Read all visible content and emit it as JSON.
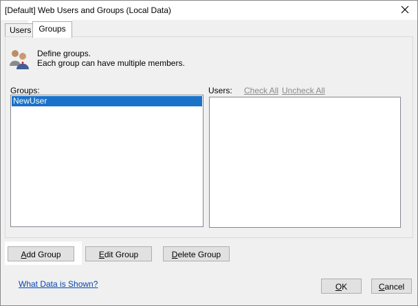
{
  "window": {
    "title": "[Default] Web Users and Groups (Local Data)"
  },
  "tabs": [
    {
      "label": "Users",
      "active": false
    },
    {
      "label": "Groups",
      "active": true
    }
  ],
  "description": {
    "line1": "Define groups.",
    "line2": "Each group can have multiple members."
  },
  "groups_list": {
    "label": "Groups:",
    "items": [
      {
        "label": "NewUser",
        "selected": true
      }
    ]
  },
  "users_list": {
    "label": "Users:",
    "check_all": "Check All",
    "uncheck_all": "Uncheck All",
    "items": []
  },
  "buttons": {
    "add_group": {
      "pre": "",
      "mnemonic": "A",
      "post": "dd Group"
    },
    "edit_group": {
      "pre": "",
      "mnemonic": "E",
      "post": "dit Group"
    },
    "delete_group": {
      "pre": "",
      "mnemonic": "D",
      "post": "elete Group"
    },
    "ok": {
      "pre": "",
      "mnemonic": "O",
      "post": "K"
    },
    "cancel": {
      "pre": "",
      "mnemonic": "C",
      "post": "ancel"
    }
  },
  "footer_link": "What Data is Shown?",
  "colors": {
    "selection": "#1a73c8",
    "link": "#0645ad",
    "disabled_link": "#8a8a8a"
  },
  "icons": {
    "group": "group-users-icon",
    "close": "close-icon"
  }
}
